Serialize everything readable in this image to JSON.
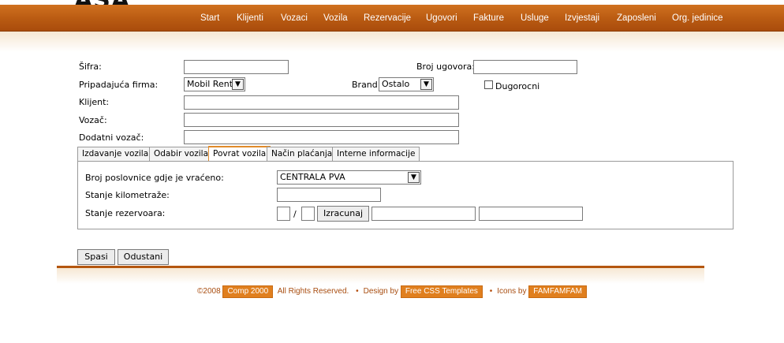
{
  "logo": "ASA",
  "nav": [
    "Start",
    "Klijenti",
    "Vozaci",
    "Vozila",
    "Rezervacije",
    "Ugovori",
    "Fakture",
    "Usluge",
    "Izvjestaji",
    "Zaposleni",
    "Org. jedinice"
  ],
  "form": {
    "sifra_label": "Šifra:",
    "sifra_value": "",
    "broj_ugovora_label": "Broj ugovora:",
    "broj_ugovora_value": "",
    "firma_label": "Pripadajuća firma:",
    "firma_value": "Mobil Rent",
    "brand_label": "Brand:",
    "brand_value": "Ostalo",
    "dugorocni_label": "Dugorocni",
    "klijent_label": "Klijent:",
    "vozac_label": "Vozač:",
    "dodatni_vozac_label": "Dodatni vozač:"
  },
  "tabs": [
    "Izdavanje vozila",
    "Odabir vozila",
    "Povrat vozila",
    "Način plaćanja",
    "Interne informacije"
  ],
  "panel": {
    "poslovnica_label": "Broj poslovnice gdje je vraćeno:",
    "poslovnica_value": "CENTRALA PVA",
    "kilometraza_label": "Stanje kilometraže:",
    "rezervoar_label": "Stanje rezervoara:",
    "slash": "/",
    "izracunaj_label": "Izracunaj"
  },
  "buttons": {
    "save": "Spasi",
    "cancel": "Odustani"
  },
  "footer": {
    "copyright": "©2008",
    "company": "Comp 2000",
    "rights": "All Rights Reserved.",
    "design_by": "Design by",
    "templates": "Free CSS Templates",
    "icons_by": "Icons by",
    "famfam": "FAMFAMFAM",
    "bullet": "•"
  }
}
